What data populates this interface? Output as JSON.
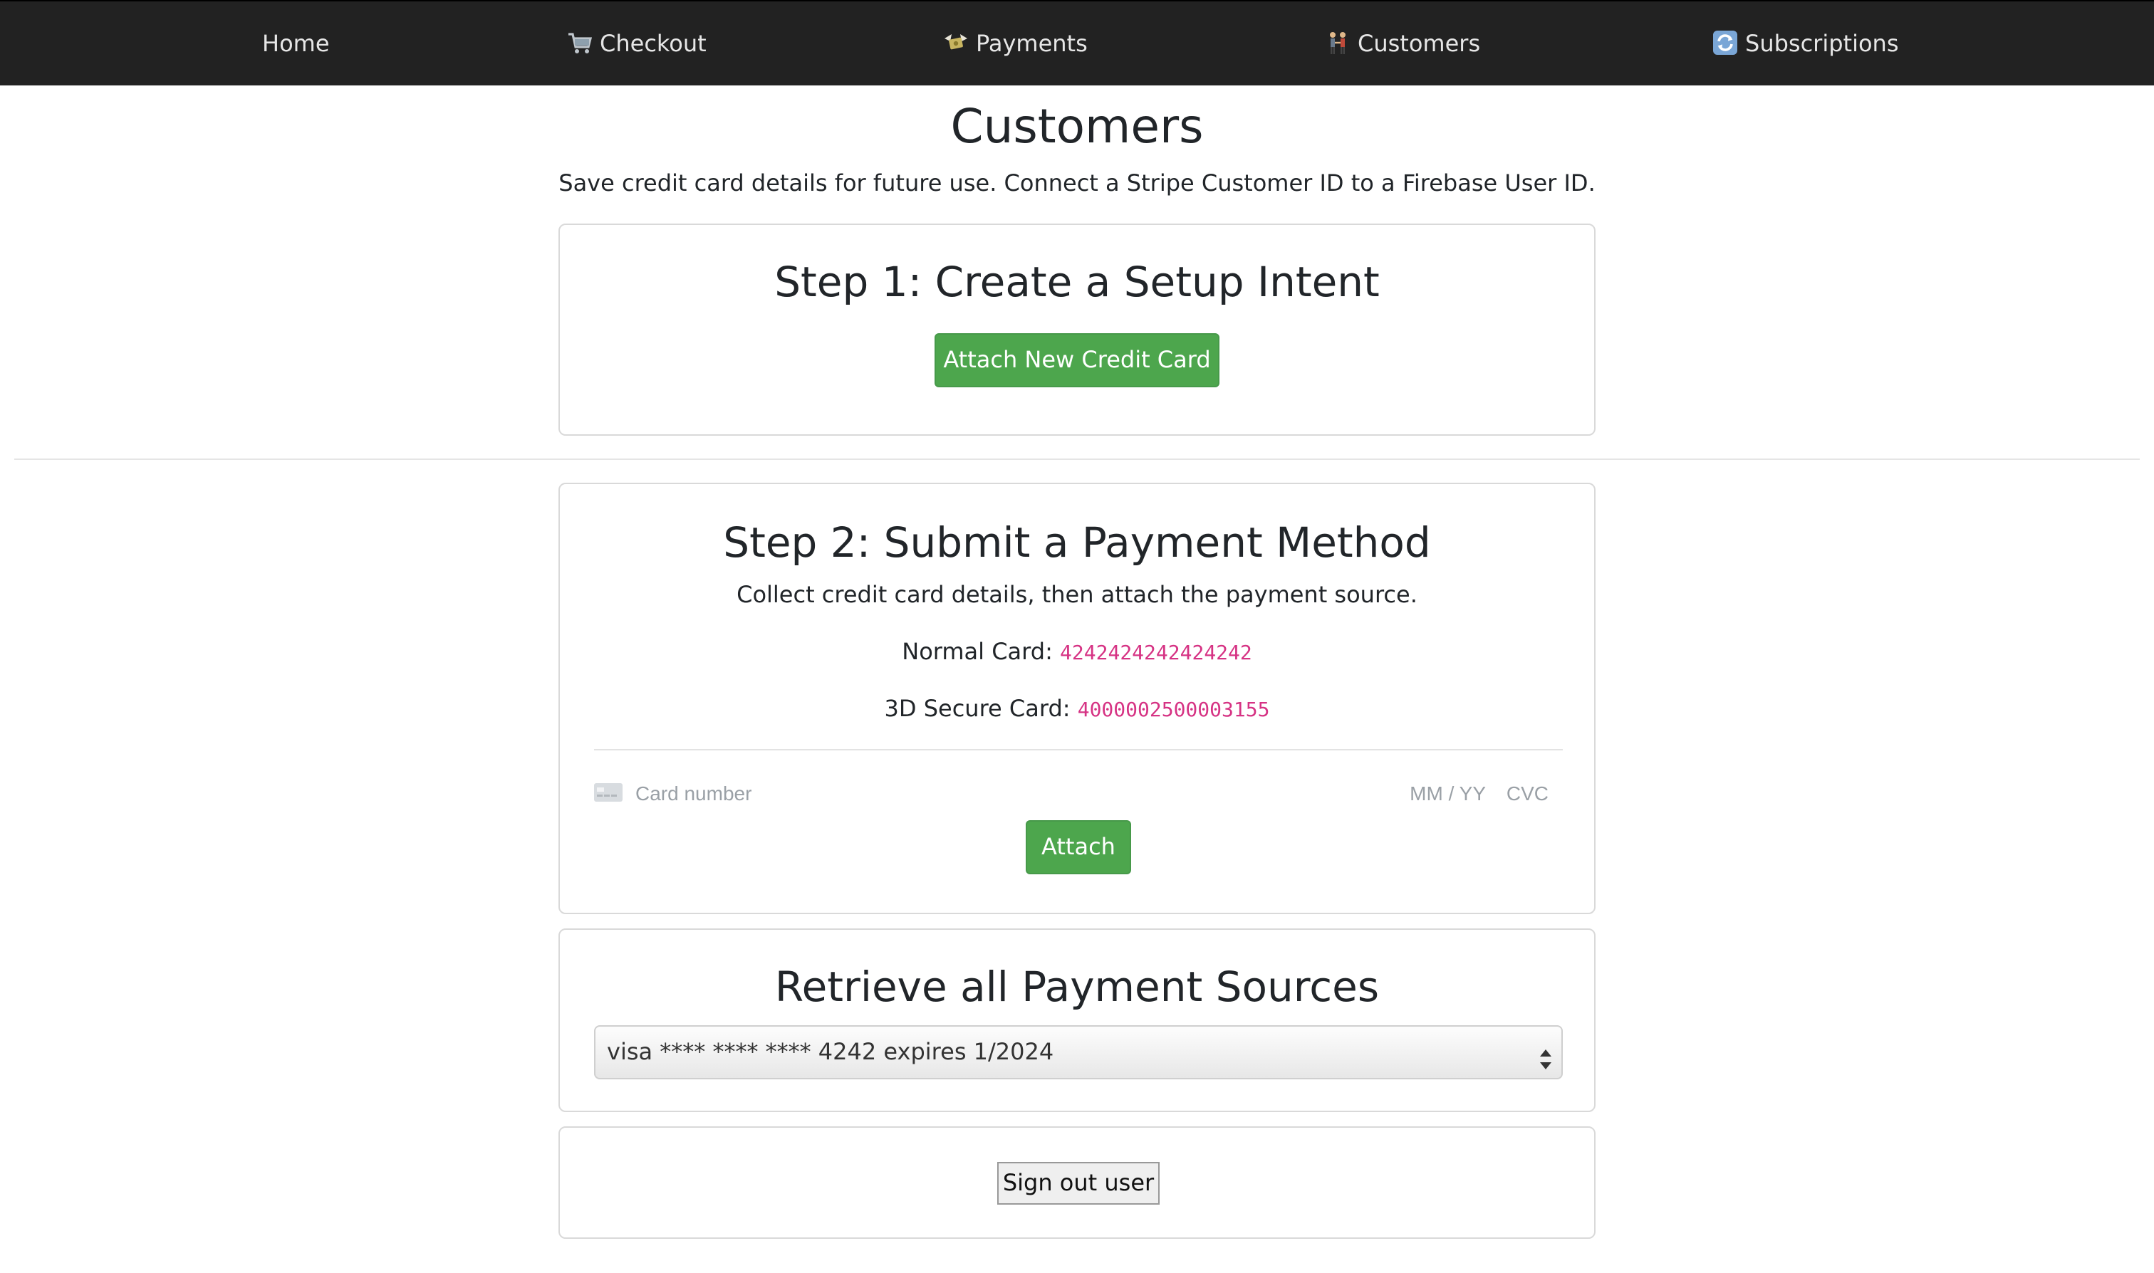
{
  "nav": {
    "items": [
      {
        "label": "Home",
        "icon": ""
      },
      {
        "label": "Checkout",
        "icon": "shopping-cart-icon"
      },
      {
        "label": "Payments",
        "icon": "money-wings-icon"
      },
      {
        "label": "Customers",
        "icon": "people-holding-hands-icon"
      },
      {
        "label": "Subscriptions",
        "icon": "refresh-arrows-icon"
      }
    ]
  },
  "page": {
    "title": "Customers",
    "lead": "Save credit card details for future use. Connect a Stripe Customer ID to a Firebase User ID."
  },
  "step1": {
    "heading": "Step 1: Create a Setup Intent",
    "button": "Attach New Credit Card"
  },
  "step2": {
    "heading": "Step 2: Submit a Payment Method",
    "description": "Collect credit card details, then attach the payment source.",
    "normal_card_label": "Normal Card:",
    "normal_card_number": "4242424242424242",
    "secure_card_label": "3D Secure Card:",
    "secure_card_number": "4000002500003155",
    "card_number_placeholder": "Card number",
    "expiry_placeholder": "MM / YY",
    "cvc_placeholder": "CVC",
    "attach_button": "Attach"
  },
  "sources": {
    "heading": "Retrieve all Payment Sources",
    "selected": "visa **** **** **** 4242 expires 1/2024"
  },
  "signout": {
    "button": "Sign out user"
  },
  "colors": {
    "navbar": "#222222",
    "button_green": "#4da64d",
    "code_pink": "#d63384"
  }
}
